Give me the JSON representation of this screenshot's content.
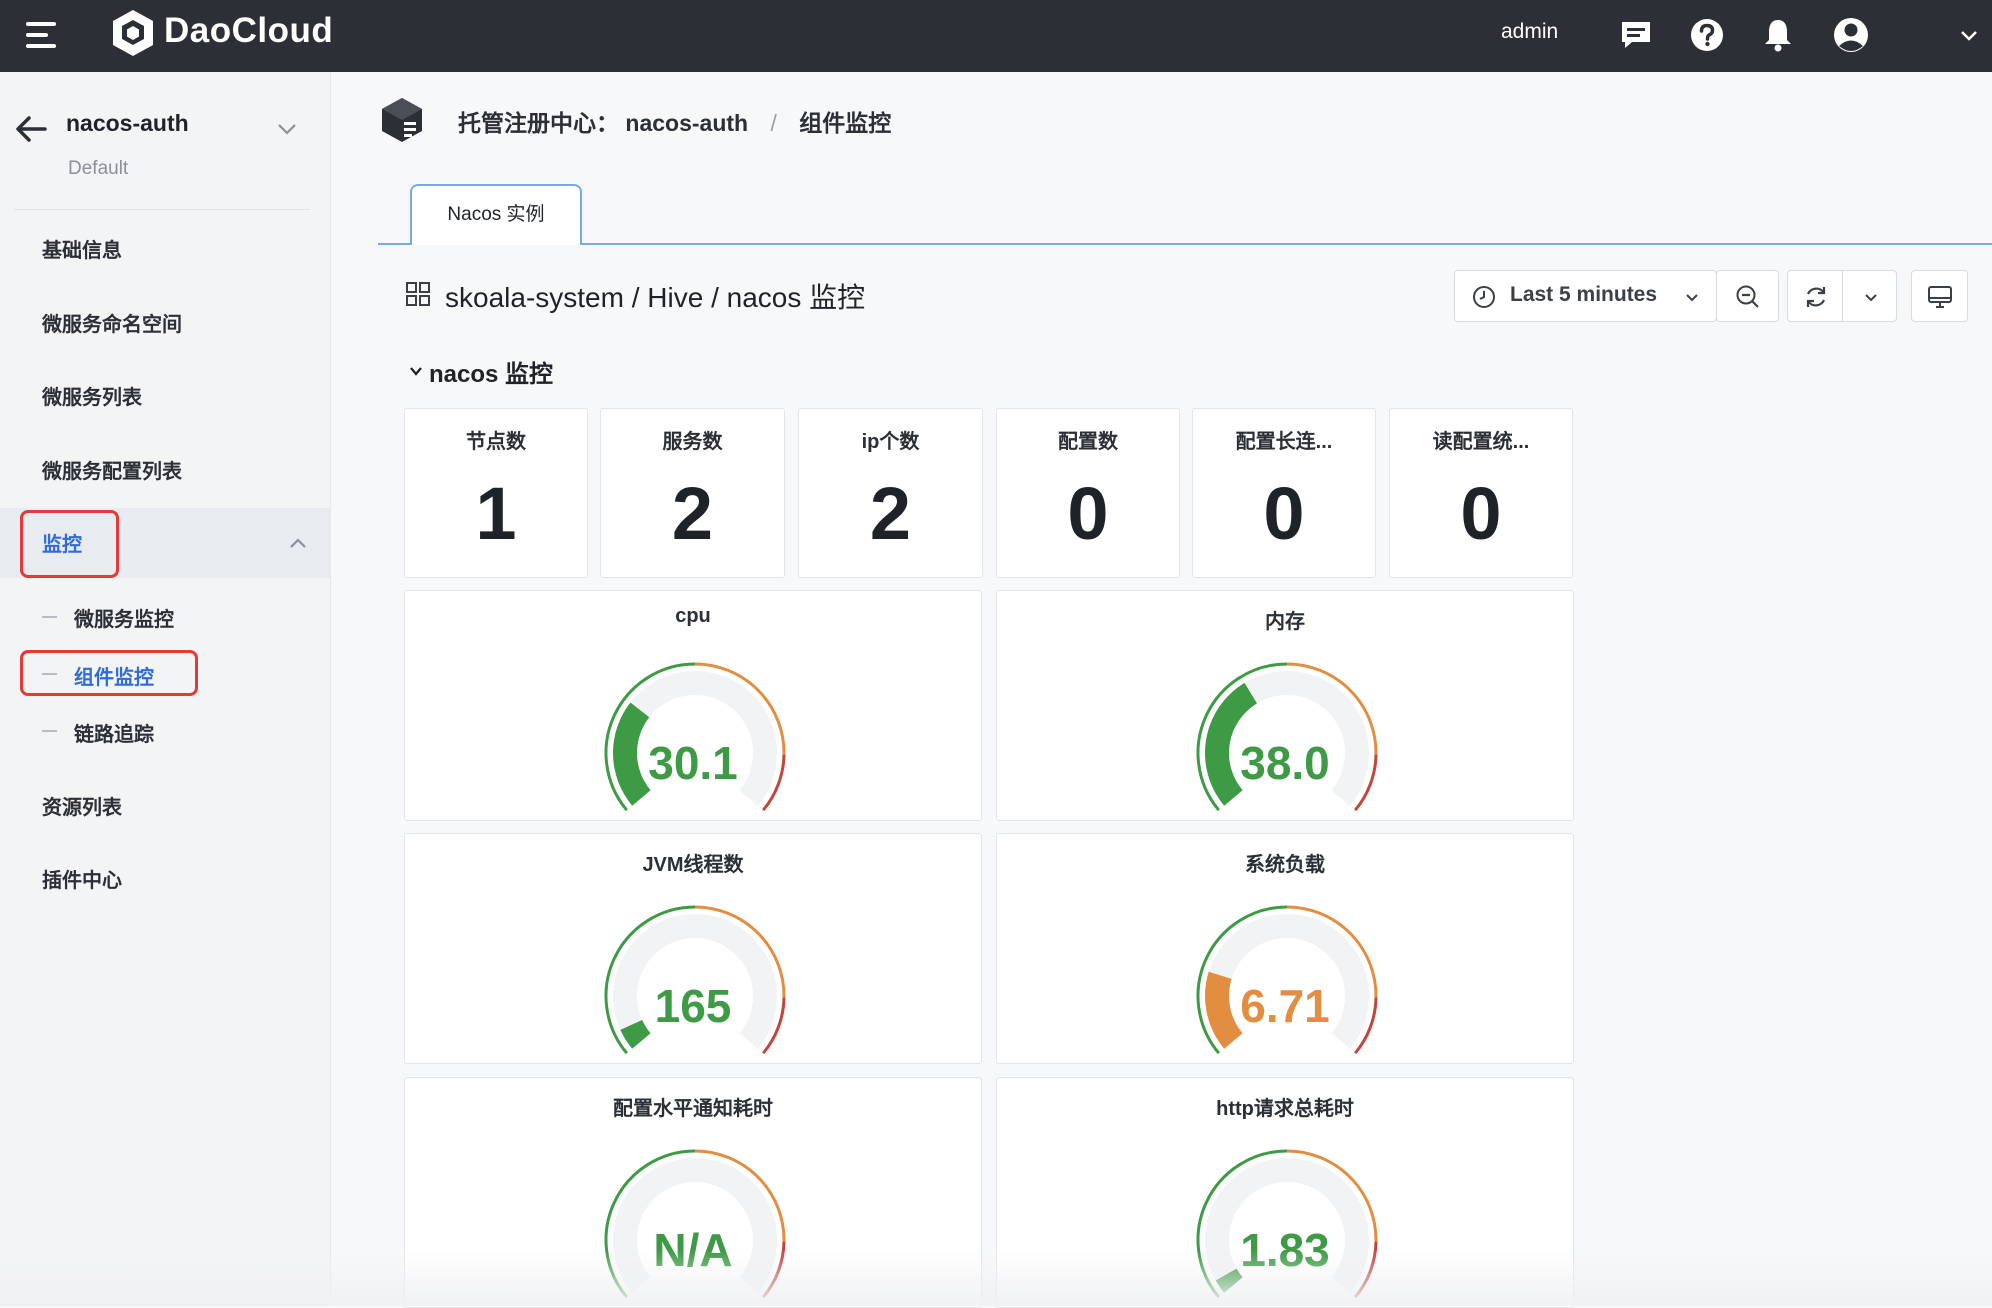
{
  "topbar": {
    "brand": "DaoCloud",
    "user": "admin"
  },
  "sidebar": {
    "app_name": "nacos-auth",
    "app_sub": "Default",
    "items": [
      {
        "label": "基础信息"
      },
      {
        "label": "微服务命名空间"
      },
      {
        "label": "微服务列表"
      },
      {
        "label": "微服务配置列表"
      },
      {
        "label": "监控"
      },
      {
        "label": "资源列表"
      },
      {
        "label": "插件中心"
      }
    ],
    "sub_items": [
      {
        "label": "微服务监控"
      },
      {
        "label": "组件监控"
      },
      {
        "label": "链路追踪"
      }
    ]
  },
  "breadcrumb": {
    "root": "托管注册中心：",
    "instance": "nacos-auth",
    "separator": "/",
    "current": "组件监控"
  },
  "tabs": [
    {
      "label": "Nacos 实例"
    }
  ],
  "dashboard": {
    "title": "skoala-system  / Hive / nacos 监控",
    "time_range": "Last 5 minutes",
    "row_title": "nacos 监控",
    "stats": [
      {
        "label": "节点数",
        "value": "1"
      },
      {
        "label": "服务数",
        "value": "2"
      },
      {
        "label": "ip个数",
        "value": "2"
      },
      {
        "label": "配置数",
        "value": "0"
      },
      {
        "label": "配置长连...",
        "value": "0"
      },
      {
        "label": "读配置统...",
        "value": "0"
      }
    ],
    "gauges": [
      {
        "title": "cpu",
        "value": "30.1",
        "fill_fraction": 0.3,
        "color": "#3f9a45"
      },
      {
        "title": "内存",
        "value": "38.0",
        "fill_fraction": 0.38,
        "color": "#3f9a45"
      },
      {
        "title": "JVM线程数",
        "value": "165",
        "fill_fraction": 0.06,
        "color": "#3f9a45"
      },
      {
        "title": "系统负载",
        "value": "6.71",
        "fill_fraction": 0.22,
        "color": "#e28d3f"
      },
      {
        "title": "配置水平通知耗时",
        "value": "N/A",
        "fill_fraction": 0.0,
        "color": "#3f9a45"
      },
      {
        "title": "http请求总耗时",
        "value": "1.83",
        "fill_fraction": 0.04,
        "color": "#3f9a45"
      }
    ]
  },
  "colors": {
    "accent": "#2f6bd9",
    "highlight": "#e53935",
    "green": "#3f9a45",
    "orange": "#e28d3f",
    "red": "#c4453c"
  },
  "icons": [
    "menu-icon",
    "daocloud-logo-icon",
    "message-icon",
    "help-icon",
    "bell-icon",
    "user-avatar-icon",
    "chevron-down-icon",
    "back-arrow-icon",
    "cube-icon",
    "grid-icon",
    "clock-icon",
    "zoom-out-icon",
    "refresh-icon",
    "tv-icon"
  ]
}
